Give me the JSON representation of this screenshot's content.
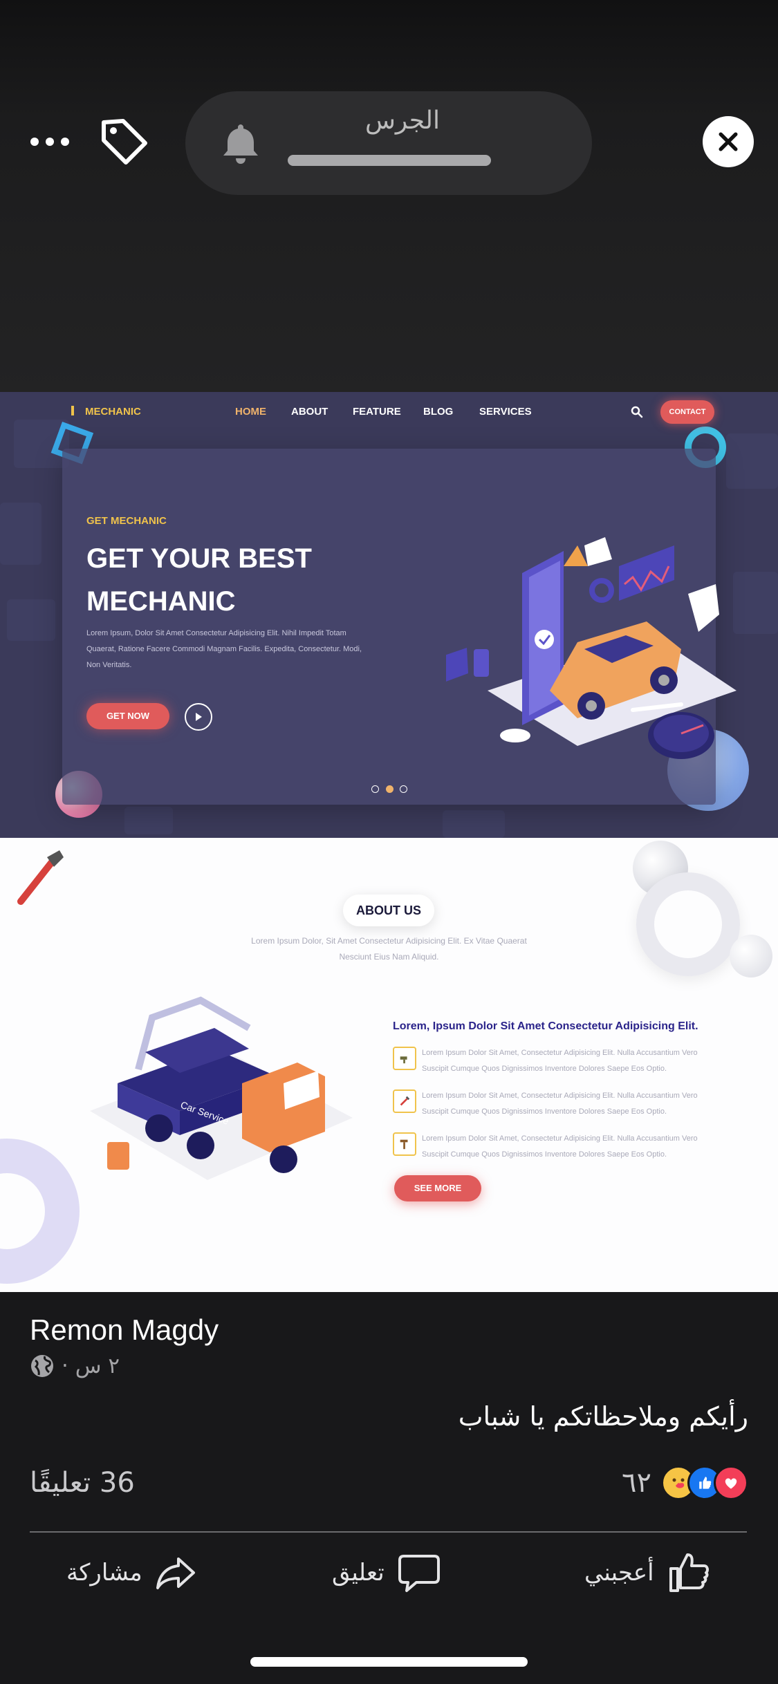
{
  "overlay": {
    "more_icon": "ellipsis-icon",
    "tag_icon": "tag-icon",
    "notification": {
      "icon": "bell-icon",
      "title": "الجرس",
      "progress": 1.0
    },
    "close_icon": "close-icon"
  },
  "website": {
    "nav": {
      "logo": "MECHANIC",
      "items": [
        "HOME",
        "ABOUT",
        "FEATURE",
        "BLOG",
        "SERVICES"
      ],
      "active_item": "HOME",
      "contact": "CONTACT"
    },
    "hero": {
      "kicker": "GET MECHANIC",
      "headline": "GET YOUR BEST MECHANIC",
      "body": "Lorem Ipsum, Dolor Sit Amet Consectetur Adipisicing Elit. Nihil Impedit Totam Quaerat, Ratione Facere Commodi Magnam Facilis. Expedita, Consectetur. Modi, Non Veritatis.",
      "cta": "GET NOW",
      "slides": 3,
      "active_slide": 2
    },
    "about": {
      "heading": "ABOUT US",
      "subtitle": "Lorem Ipsum Dolor, Sit Amet Consectetur Adipisicing Elit. Ex Vitae Quaerat Nesciunt Eius Nam Aliquid.",
      "feature_title": "Lorem, Ipsum Dolor Sit Amet Consectetur Adipisicing Elit.",
      "features": [
        "Lorem Ipsum Dolor Sit Amet, Consectetur Adipisicing Elit. Nulla Accusantium Vero Suscipit Cumque Quos Dignissimos Inventore Dolores Saepe Eos Optio.",
        "Lorem Ipsum Dolor Sit Amet, Consectetur Adipisicing Elit. Nulla Accusantium Vero Suscipit Cumque Quos Dignissimos Inventore Dolores Saepe Eos Optio.",
        "Lorem Ipsum Dolor Sit Amet, Consectetur Adipisicing Elit. Nulla Accusantium Vero Suscipit Cumque Quos Dignissimos Inventore Dolores Saepe Eos Optio."
      ],
      "cta": "SEE MORE",
      "truck_text": "Car Service"
    }
  },
  "post": {
    "author": "Remon Magdy",
    "time": "٢ س ·",
    "privacy_icon": "globe-icon",
    "caption": "رأيكم وملاحظاتكم يا شباب",
    "comments": "36 تعليقًا",
    "reactions_count": "٦٢",
    "reaction_icons": [
      "love-icon",
      "like-icon",
      "care-icon"
    ],
    "actions": {
      "like": "أعجبني",
      "comment": "تعليق",
      "share": "مشاركة"
    }
  },
  "colors": {
    "background": "#18181a",
    "brand_red": "#e05b5b",
    "brand_yellow": "#f0c34b",
    "like_blue": "#1877f2",
    "love_red": "#f33e58"
  }
}
